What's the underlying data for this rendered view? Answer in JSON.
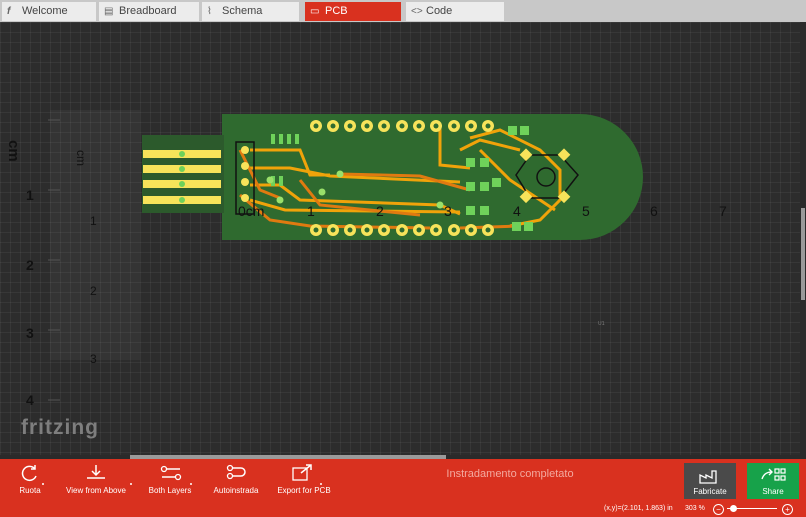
{
  "tabs": [
    {
      "label": "Welcome",
      "icon": "fritzing-f-icon"
    },
    {
      "label": "Breadboard",
      "icon": "breadboard-icon"
    },
    {
      "label": "Schema",
      "icon": "schematic-icon"
    },
    {
      "label": "PCB",
      "icon": "pcb-icon",
      "active": true
    },
    {
      "label": "Code",
      "icon": "code-icon"
    }
  ],
  "ruler": {
    "unit": "cm",
    "vertical_big": [
      "1",
      "2",
      "3",
      "4"
    ],
    "vertical_mid": [
      "1",
      "2",
      "3"
    ],
    "horizontal": [
      "0cm",
      "1",
      "2",
      "3",
      "4",
      "5",
      "6",
      "7"
    ]
  },
  "brand": "fritzing",
  "toolbar": {
    "rotate": "Ruota",
    "view": "View from Above",
    "layers": "Both Layers",
    "autoroute": "Autoinstrada",
    "export": "Export for PCB"
  },
  "status_message": "Instradamento completato",
  "fabricate": "Fabricate",
  "share": "Share",
  "statusbar": {
    "coords": "(x,y)=(2.101, 1.863) in",
    "zoom": "303 %"
  },
  "colors": {
    "accent": "#d9311f",
    "board": "#2f6a2f",
    "trace_top": "#f0a30a",
    "trace_bottom": "#e07a10",
    "share": "#17a24a"
  }
}
